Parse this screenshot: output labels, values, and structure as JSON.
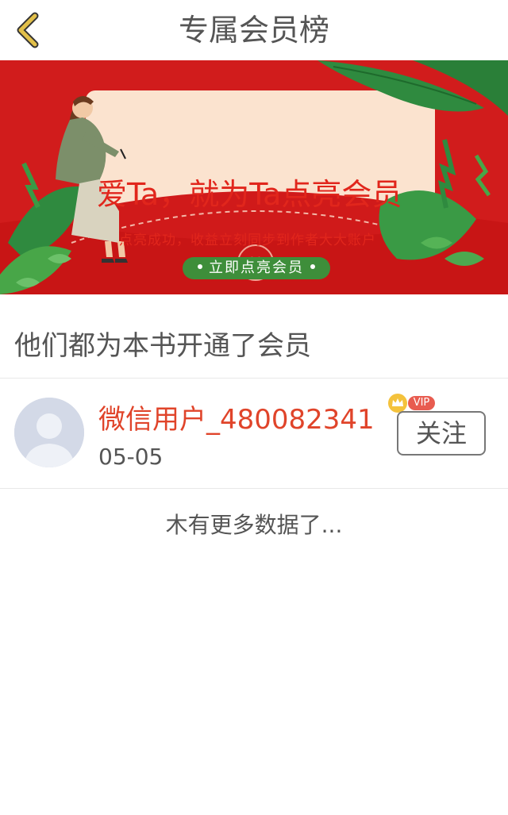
{
  "header": {
    "title": "专属会员榜",
    "back_icon": "chevron-left-icon",
    "accent_color": "#e2c04a"
  },
  "banner": {
    "title": "爱Ta，就为Ta点亮会员",
    "subtitle": "点亮成功，收益立刻同步到作者大大账户",
    "cta_label": "立即点亮会员",
    "background_color": "#d71f1f",
    "card_color": "#fbe3cf",
    "cta_color": "#3e8e3a"
  },
  "section": {
    "title": "他们都为本书开通了会员"
  },
  "members": [
    {
      "name": "微信用户_480082341",
      "date": "05-05",
      "badge": "VIP",
      "follow_label": "关注"
    }
  ],
  "footer": {
    "no_more_text": "木有更多数据了..."
  }
}
